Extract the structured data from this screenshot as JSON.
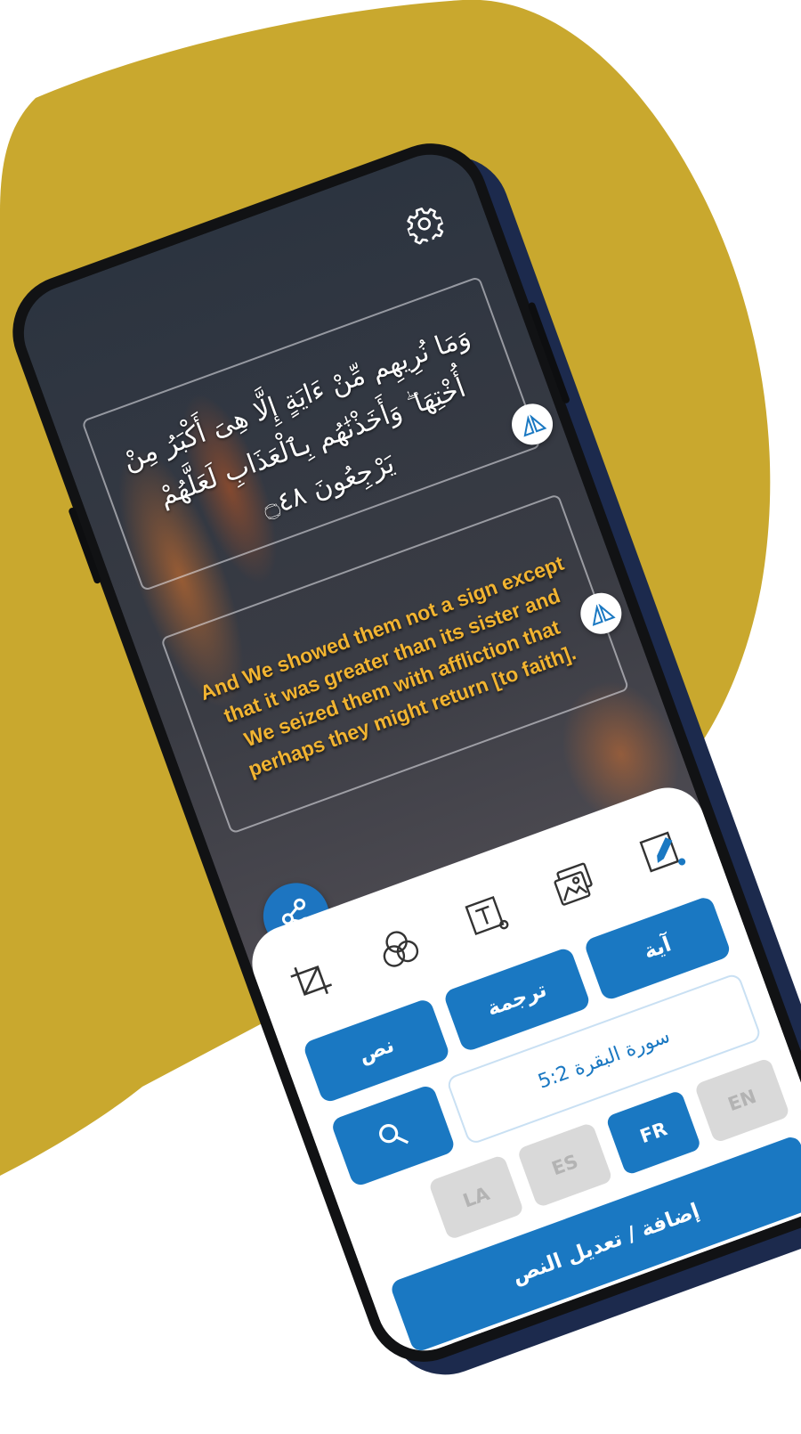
{
  "colors": {
    "brand_gold": "#c9a82e",
    "primary_blue": "#1a78c2",
    "translation_text": "#f2b431",
    "inactive_lang": "#d9d9d9",
    "phone_shadow": "#1c2a4d"
  },
  "verse": {
    "arabic": "وَمَا نُرِيهِم مِّنْ ءَايَةٍ إِلَّا هِىَ أَكْبَرُ مِنْ أُخْتِهَا ۖ وَأَخَذْنَٰهُم بِٱلْعَذَابِ لَعَلَّهُمْ يَرْجِعُونَ ۝٤٨",
    "translation": "And We showed them not a sign except that it was greater than its sister and We seized them with affliction that perhaps they might return [to faith]."
  },
  "icons": {
    "settings": "gear-icon",
    "share": "share-icon",
    "flip": "flip-icon",
    "tools": [
      "crop-icon",
      "blend-icon",
      "text-style-icon",
      "image-gallery-icon",
      "edit-pen-icon"
    ],
    "search": "search-icon"
  },
  "tabs": {
    "text": "نص",
    "translation": "ترجمة",
    "verse": "آية"
  },
  "search": {
    "reference_value": "سورة البقرة 5:2"
  },
  "languages": [
    {
      "code": "EN",
      "active": false
    },
    {
      "code": "FR",
      "active": true
    },
    {
      "code": "ES",
      "active": false
    },
    {
      "code": "LA",
      "active": false
    }
  ],
  "submit_label": "إضافة / تعديل النص"
}
